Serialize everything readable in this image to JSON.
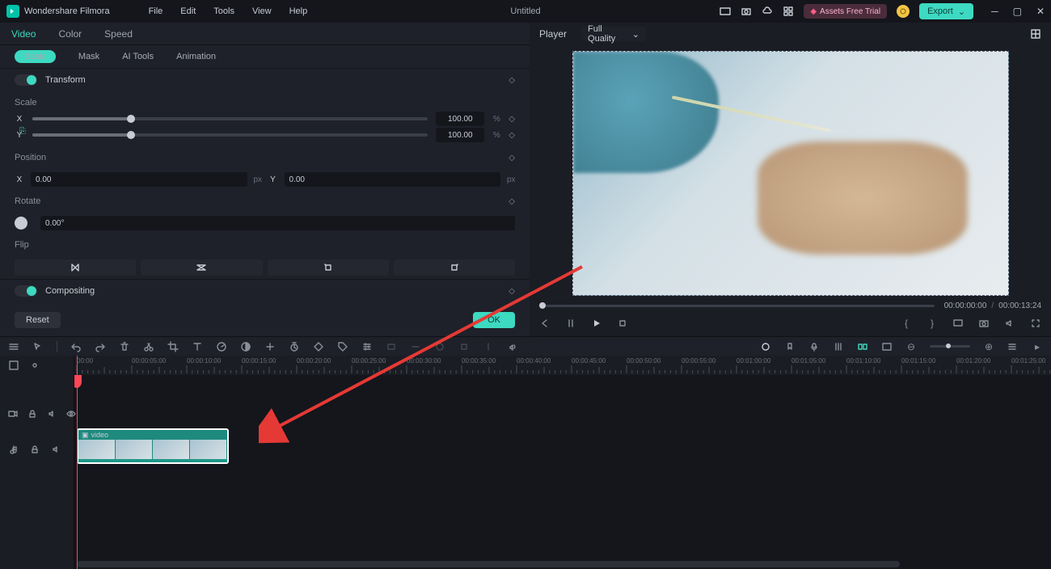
{
  "title_bar": {
    "app": "Wondershare Filmora",
    "menus": [
      "File",
      "Edit",
      "Tools",
      "View",
      "Help"
    ],
    "doc": "Untitled",
    "assets_label": "Assets Free Trial",
    "export": "Export"
  },
  "panel": {
    "tabs": [
      "Video",
      "Color",
      "Speed"
    ],
    "subtabs": [
      "Basic",
      "Mask",
      "AI Tools",
      "Animation"
    ],
    "transform": {
      "label": "Transform"
    },
    "scale": {
      "label": "Scale",
      "x": "X",
      "y": "Y",
      "xval": "100.00",
      "yval": "100.00",
      "unit": "%"
    },
    "position": {
      "label": "Position",
      "x": "X",
      "y": "Y",
      "xval": "0.00",
      "yval": "0.00",
      "unit": "px"
    },
    "rotate": {
      "label": "Rotate",
      "val": "0.00°"
    },
    "flip": {
      "label": "Flip"
    },
    "compositing": {
      "label": "Compositing"
    },
    "reset": "Reset",
    "ok": "OK"
  },
  "player": {
    "label": "Player",
    "quality": "Full Quality",
    "cur": "00:00:00:00",
    "dur": "00:00:13:24"
  },
  "timeline": {
    "clip_label": "video",
    "ticks": [
      "00:00",
      "00:00:05:00",
      "00:00:10:00",
      "00:00:15:00",
      "00:00:20:00",
      "00:00:25:00",
      "00:00:30:00",
      "00:00:35:00",
      "00:00:40:00",
      "00:00:45:00",
      "00:00:50:00",
      "00:00:55:00",
      "00:01:00:00",
      "00:01:05:00",
      "00:01:10:00",
      "00:01:15:00",
      "00:01:20:00",
      "00:01:25:00"
    ]
  }
}
